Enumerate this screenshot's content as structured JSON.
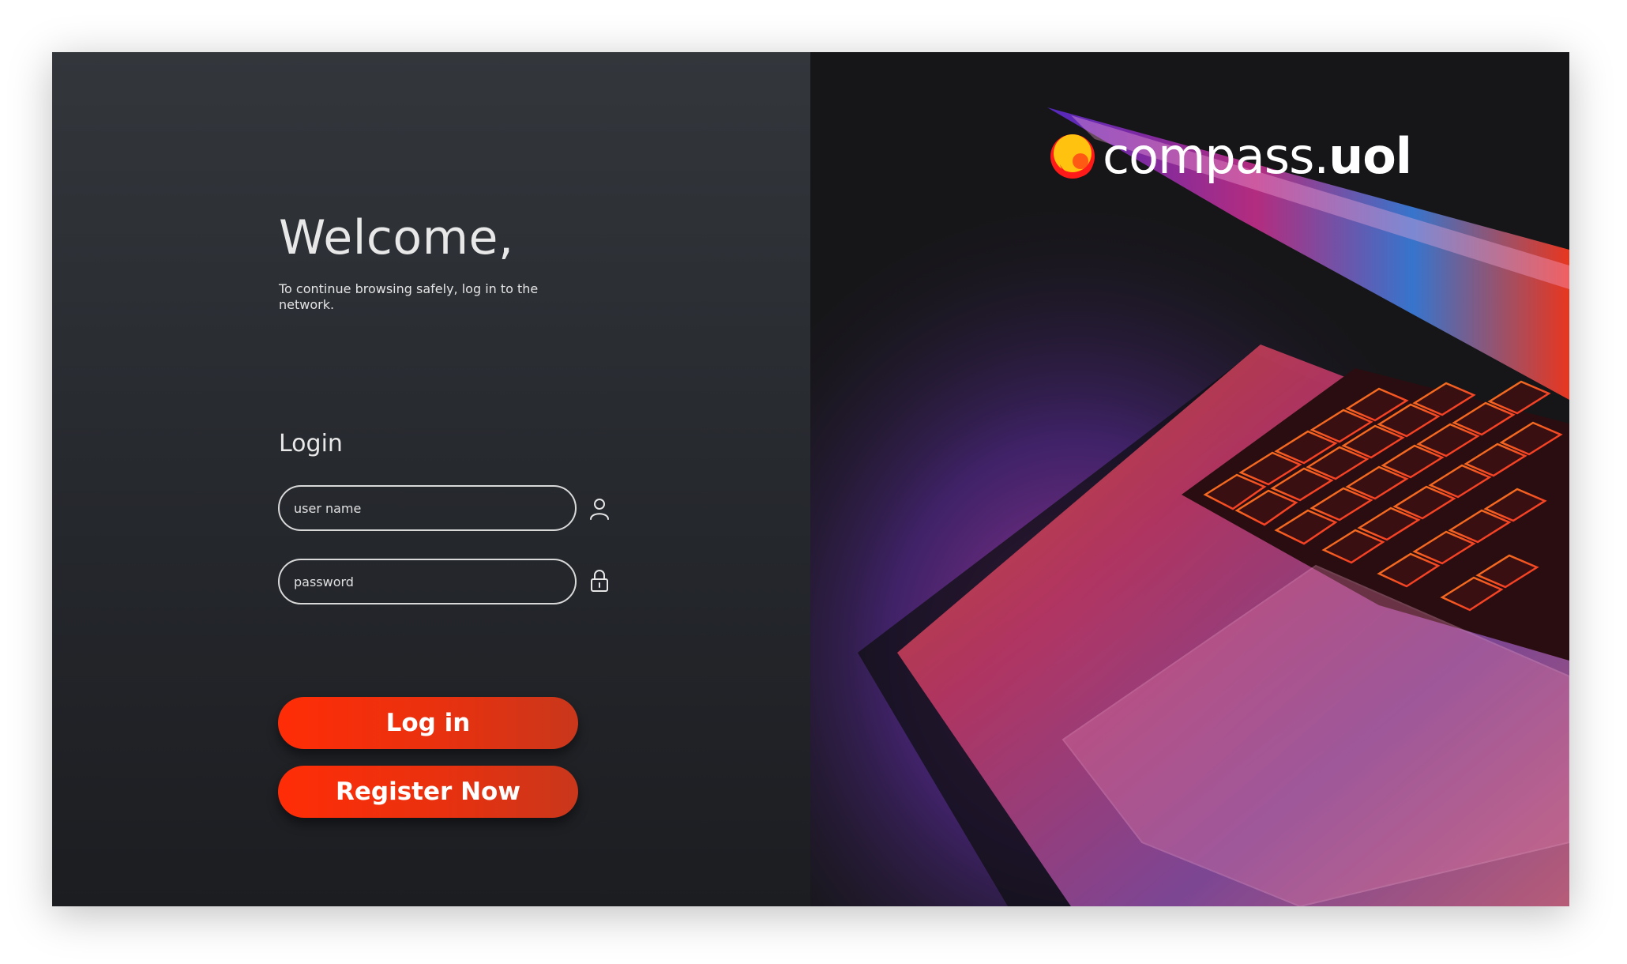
{
  "welcome": {
    "title": "Welcome,",
    "subtitle": "To continue browsing safely, log in to the network."
  },
  "login": {
    "heading": "Login",
    "username_placeholder": "user name",
    "password_placeholder": "password",
    "username_icon": "user-icon",
    "password_icon": "lock-icon",
    "login_button": "Log in",
    "register_button": "Register Now"
  },
  "brand": {
    "logo_text_main": "compass.",
    "logo_text_bold": "uol",
    "logo_icon": "compass-logo-mark",
    "colors": {
      "accent": "#ff2d07",
      "logo_yellow": "#ffc20e",
      "logo_red": "#ff1a1a"
    }
  },
  "background": {
    "left_gradient_top": "#33373c",
    "left_gradient_bottom": "#1c1d21"
  }
}
